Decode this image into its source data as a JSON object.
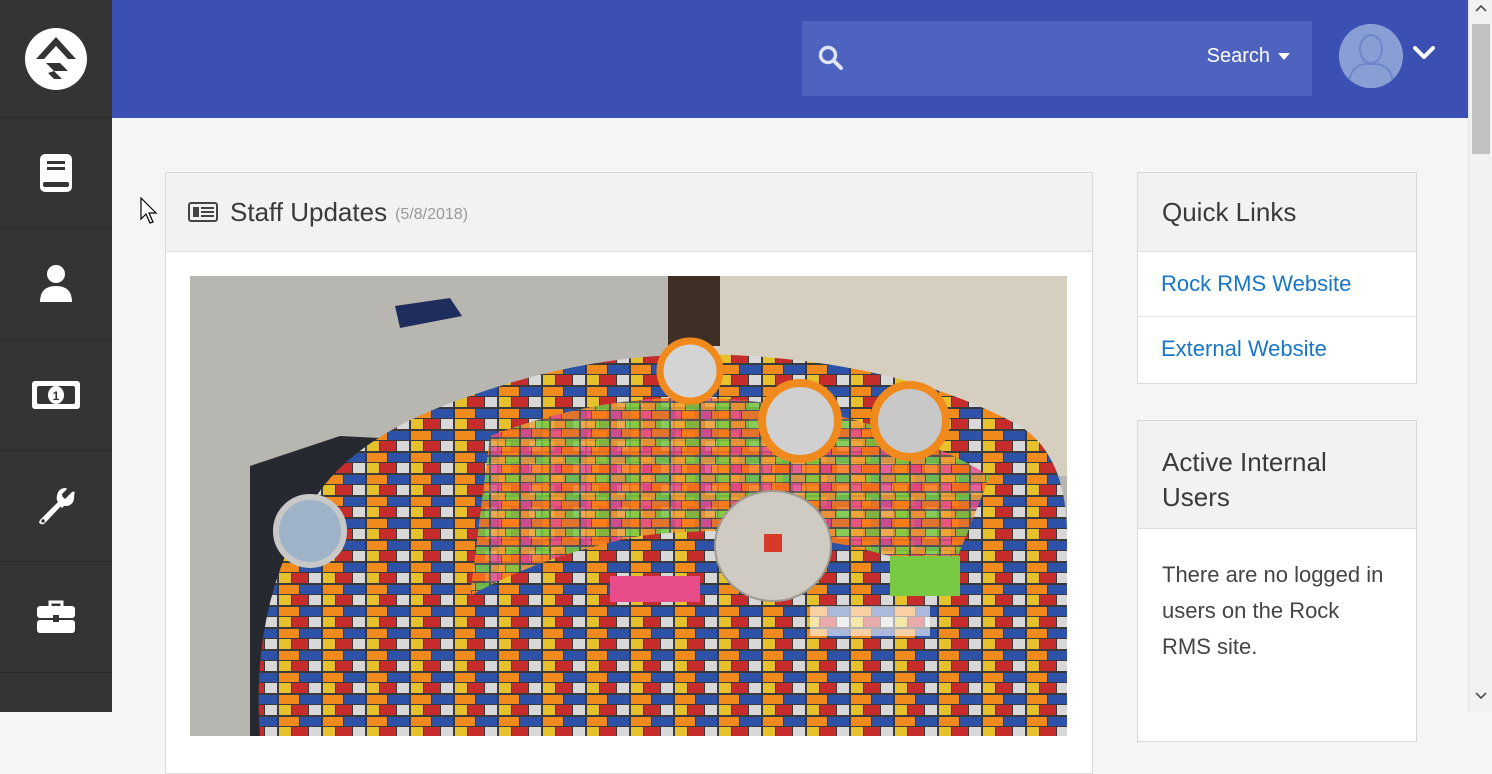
{
  "nav": {
    "logo_icon": "rock-logo-icon",
    "items": [
      {
        "name": "nav-item-content",
        "icon": "book-icon"
      },
      {
        "name": "nav-item-people",
        "icon": "person-icon"
      },
      {
        "name": "nav-item-finance",
        "icon": "money-icon"
      },
      {
        "name": "nav-item-admin-tools",
        "icon": "wrench-icon"
      },
      {
        "name": "nav-item-tools",
        "icon": "briefcase-icon"
      }
    ]
  },
  "header": {
    "search": {
      "value": "",
      "filter_label": "Search"
    },
    "avatar_icon": "avatar-icon"
  },
  "colors": {
    "header_bg": "#3c50b4",
    "search_bg": "#4e63bf",
    "nav_bg": "#343434",
    "link": "#1776c7"
  },
  "staff_updates": {
    "title": "Staff Updates",
    "date": "(5/8/2018)",
    "icon": "newspaper-icon",
    "image": "lego-millennium-falcon-photo"
  },
  "quick_links": {
    "title": "Quick Links",
    "links": [
      "Rock RMS Website",
      "External Website"
    ]
  },
  "active_users": {
    "title": "Active Internal Users",
    "message": "There are no logged in users on the Rock RMS site."
  }
}
